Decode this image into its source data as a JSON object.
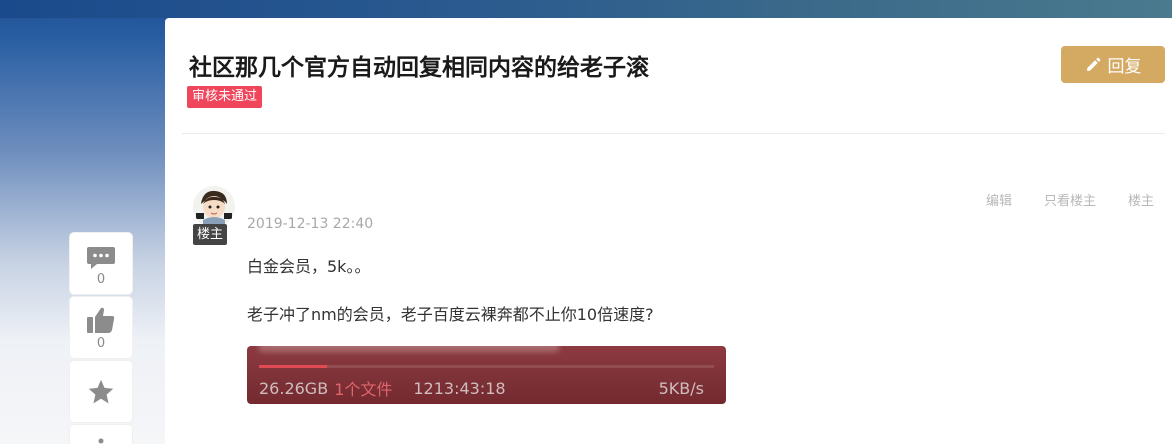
{
  "thread": {
    "title": "社区那几个官方自动回复相同内容的给老子滚",
    "status_badge": "审核未通过",
    "reply_label": "回复"
  },
  "post": {
    "author_tag": "楼主",
    "time": "2019-12-13 22:40",
    "actions": [
      "编辑",
      "只看楼主",
      "楼主"
    ],
    "lines": [
      "白金会员，5k。。",
      "老子冲了nm的会员，老子百度云裸奔都不止你10倍速度?"
    ],
    "download_image": {
      "size": "26.26GB",
      "files": "1个文件",
      "remaining": "1213:43:18",
      "speed": "5KB/s",
      "progress_fraction": 0.15
    }
  },
  "sidebar": {
    "comment_count": "0",
    "like_count": "0"
  },
  "colors": {
    "accent": "#d4a962",
    "badge": "#f0465c",
    "dl_progress": "#e04a52"
  }
}
